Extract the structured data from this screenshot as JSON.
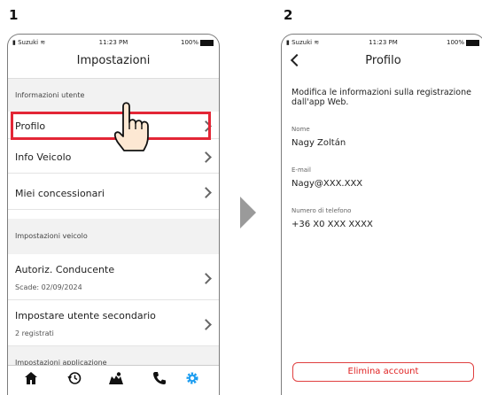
{
  "steps": [
    "1",
    "2"
  ],
  "status_bar": {
    "carrier": "Suzuki",
    "time": "11:23 PM",
    "battery": "100%"
  },
  "screen1": {
    "title": "Impostazioni",
    "sections": {
      "user_info": "Informazioni utente",
      "vehicle_settings": "Impostazioni veicolo",
      "app_settings": "Impostazioni applicazione"
    },
    "items": {
      "profile": "Profilo",
      "vehicle_info": "Info Veicolo",
      "dealers": "Miei concessionari",
      "authorized_driver": "Autoriz. Conducente",
      "authorized_driver_sub": "Scade: 02/09/2024",
      "secondary_user": "Impostare utente secondario",
      "secondary_user_sub": "2 registrati"
    },
    "tabbar": [
      "home-icon",
      "history-icon",
      "map-icon",
      "phone-icon",
      "settings-icon"
    ],
    "highlight_color": "#e32636",
    "active_tab_color": "#1a9cf0"
  },
  "screen2": {
    "title": "Profilo",
    "description": "Modifica le informazioni sulla registrazione dall'app Web.",
    "fields": [
      {
        "label": "Nome",
        "value": "Nagy Zoltán"
      },
      {
        "label": "E-mail",
        "value": "Nagy@XXX.XXX"
      },
      {
        "label": "Numero di telefono",
        "value": "+36 X0 XXX XXXX"
      }
    ],
    "delete_button": "Elimina account",
    "delete_color": "#e02020"
  }
}
